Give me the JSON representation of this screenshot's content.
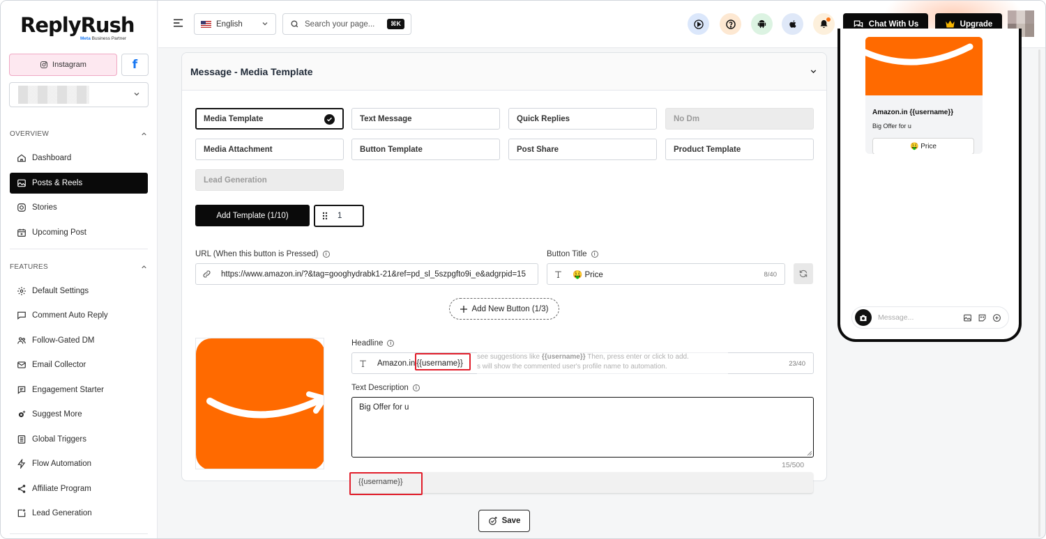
{
  "brand": {
    "name": "ReplyRush",
    "partner_meta": "Meta",
    "partner_text": "Business Partner"
  },
  "platforms": {
    "instagram_label": "Instagram",
    "facebook_label": "f"
  },
  "sidebar": {
    "overview_title": "OVERVIEW",
    "features_title": "FEATURES",
    "overview_items": [
      {
        "label": "Dashboard",
        "icon": "home-icon"
      },
      {
        "label": "Posts & Reels",
        "icon": "image-icon",
        "active": true
      },
      {
        "label": "Stories",
        "icon": "instagram-icon"
      },
      {
        "label": "Upcoming Post",
        "icon": "calendar-icon"
      }
    ],
    "feature_items": [
      {
        "label": "Default Settings",
        "icon": "gear-icon"
      },
      {
        "label": "Comment Auto Reply",
        "icon": "comment-icon"
      },
      {
        "label": "Follow-Gated DM",
        "icon": "users-icon"
      },
      {
        "label": "Email Collector",
        "icon": "mail-icon"
      },
      {
        "label": "Engagement Starter",
        "icon": "chat-icon"
      },
      {
        "label": "Suggest More",
        "icon": "cog-spark-icon"
      },
      {
        "label": "Global Triggers",
        "icon": "list-icon"
      },
      {
        "label": "Flow Automation",
        "icon": "bolt-icon"
      },
      {
        "label": "Affiliate Program",
        "icon": "share-icon"
      },
      {
        "label": "Lead Generation",
        "icon": "lead-icon"
      }
    ]
  },
  "topbar": {
    "language": "English",
    "search_placeholder": "Search your page...",
    "shortcut": "⌘K",
    "chat_label": "Chat With Us",
    "upgrade_label": "Upgrade"
  },
  "card": {
    "title": "Message - Media Template",
    "options": [
      {
        "label": "Media Template",
        "state": "selected"
      },
      {
        "label": "Text Message",
        "state": "normal"
      },
      {
        "label": "Quick Replies",
        "state": "normal"
      },
      {
        "label": "No Dm",
        "state": "disabled"
      },
      {
        "label": "Media Attachment",
        "state": "normal"
      },
      {
        "label": "Button Template",
        "state": "normal"
      },
      {
        "label": "Post Share",
        "state": "normal"
      },
      {
        "label": "Product Template",
        "state": "normal"
      },
      {
        "label": "Lead Generation",
        "state": "disabled"
      }
    ],
    "add_template_label": "Add Template (1/10)",
    "template_index": "1",
    "url_label": "URL (When this button is Pressed)",
    "url_value": "https://www.amazon.in/?&tag=googhydrabk1-21&ref=pd_sl_5szpgfto9i_e&adgrpid=15",
    "button_title_label": "Button Title",
    "button_title_value": "🤑 Price",
    "button_title_count": "8/40",
    "add_button_label": "Add New Button (1/3)",
    "headline_label": "Headline",
    "headline_prefix": "Amazon.in",
    "headline_var": "{{username}}",
    "headline_count": "23/40",
    "tip_pre": "see suggestions like",
    "tip_var": "{{username}}",
    "tip_post": "Then, press enter or click to add.",
    "tip_line2": "s will show the commented user's profile name to automation.",
    "desc_label": "Text Description",
    "desc_value": "Big Offer for u",
    "desc_count": "15/500",
    "suggestion": "{{username}}",
    "save_label": "Save"
  },
  "preview": {
    "title": "Amazon.in {{username}}",
    "desc": "Big Offer for u",
    "button": "🤑 Price",
    "message_placeholder": "Message..."
  },
  "colors": {
    "accent": "#0a0a0a",
    "brand_orange": "#ff6a00",
    "highlight_red": "#e11d2a",
    "instagram_pink": "#fde8f0"
  }
}
